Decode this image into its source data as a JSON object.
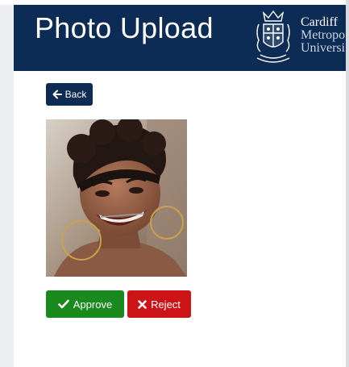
{
  "header": {
    "title": "Photo Upload",
    "logo": {
      "line1": "Cardiff",
      "line2": "Metropo",
      "line3": "Universi"
    }
  },
  "toolbar": {
    "back_label": "Back"
  },
  "review": {
    "photo_icon": "portrait-photo",
    "approve_label": "Approve",
    "reject_label": "Reject"
  },
  "colors": {
    "header_bg": "#0c2b55",
    "approve": "#1a8a1f",
    "reject": "#cc1316",
    "back": "#0c2b55"
  }
}
